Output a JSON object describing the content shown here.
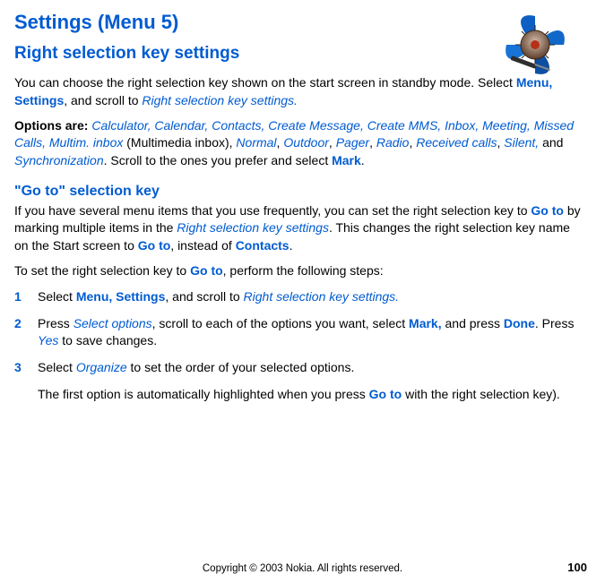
{
  "title": "Settings (Menu 5)",
  "subheading": "Right selection key settings",
  "intro": {
    "p1_part1": "You can choose the right selection key shown on the start screen in standby mode. Select ",
    "menu_settings": "Menu, Settings",
    "comma_scroll": ", and scroll to ",
    "right_sel_key": "Right selection key settings."
  },
  "options": {
    "label": "Options are: ",
    "list1": "Calculator, Calendar, Contacts, Create Message, Create MMS, Inbox, Meeting, Missed Calls, Multim. inbox",
    "after_inbox": " (Multimedia inbox),  ",
    "normal": "Normal",
    "outdoor": "Outdoor",
    "pager": "Pager",
    "radio": "Radio",
    "received": "Received calls",
    "silent": "Silent,",
    "and": " and ",
    "sync": "Synchronization",
    "tail": ".  Scroll to the ones you prefer and select ",
    "mark": "Mark",
    "period": "."
  },
  "goto": {
    "heading": "\"Go to\" selection key",
    "p1_a": "If you have several menu items that you use frequently, you can set the right selection key to ",
    "goto_label": "Go to",
    "p1_b": " by marking multiple items in the ",
    "rsk": "Right selection key settings",
    "p1_c": ".  This changes the right selection key name on the Start screen to ",
    "p1_d": ", instead of ",
    "contacts": "Contacts",
    "p1_e": ".",
    "p2_a": "To set the right selection key to ",
    "p2_b": ", perform the following steps:"
  },
  "steps": {
    "s1": {
      "num": "1",
      "a": "Select ",
      "menu_settings": "Menu, Settings",
      "b": ", and scroll to ",
      "rsk": "Right selection key settings."
    },
    "s2": {
      "num": "2",
      "a": "Press ",
      "select_options": "Select options",
      "b": ", scroll to each of the options you want, select ",
      "mark": "Mark,",
      "c": " and press ",
      "done": "Done",
      "d": ".  Press ",
      "yes": "Yes",
      "e": " to save changes."
    },
    "s3": {
      "num": "3",
      "a": "Select ",
      "organize": "Organize",
      "b": " to set the order of your selected options."
    },
    "follow": {
      "a": "The first option is automatically highlighted when you press ",
      "goto": "Go to",
      "b": " with the right selection key)."
    }
  },
  "footer": {
    "copyright": "Copyright © 2003 Nokia. All rights reserved.",
    "page": "100"
  }
}
